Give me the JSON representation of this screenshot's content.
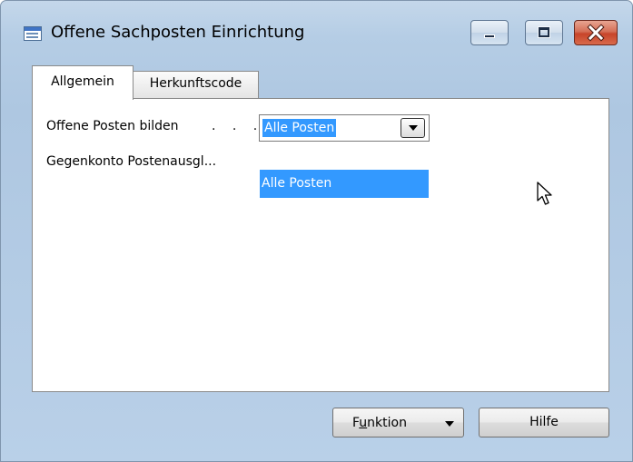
{
  "window": {
    "title": "Offene Sachposten Einrichtung",
    "icon": "table-form-icon"
  },
  "titlebar_buttons": {
    "minimize_icon": "minimize-icon",
    "maximize_icon": "maximize-icon",
    "close_icon": "close-icon"
  },
  "tabs": [
    {
      "label": "Allgemein",
      "active": true
    },
    {
      "label": "Herkunftscode",
      "active": false
    }
  ],
  "fields": {
    "offene_posten": {
      "label": "Offene Posten bilden",
      "dots": ". . .",
      "value": "Alle Posten"
    },
    "gegenkonto": {
      "label": "Gegenkonto Postenausgl..."
    }
  },
  "dropdown": {
    "options": [
      "",
      "Alle Posten"
    ],
    "highlighted": "Alle Posten"
  },
  "buttons": {
    "funktion_accel": "u",
    "funktion_prefix": "F",
    "funktion_suffix": "nktion",
    "hilfe": "Hilfe"
  },
  "colors": {
    "selection": "#3399ff",
    "close_button": "#c7442a",
    "chrome": "#b5cde5"
  }
}
